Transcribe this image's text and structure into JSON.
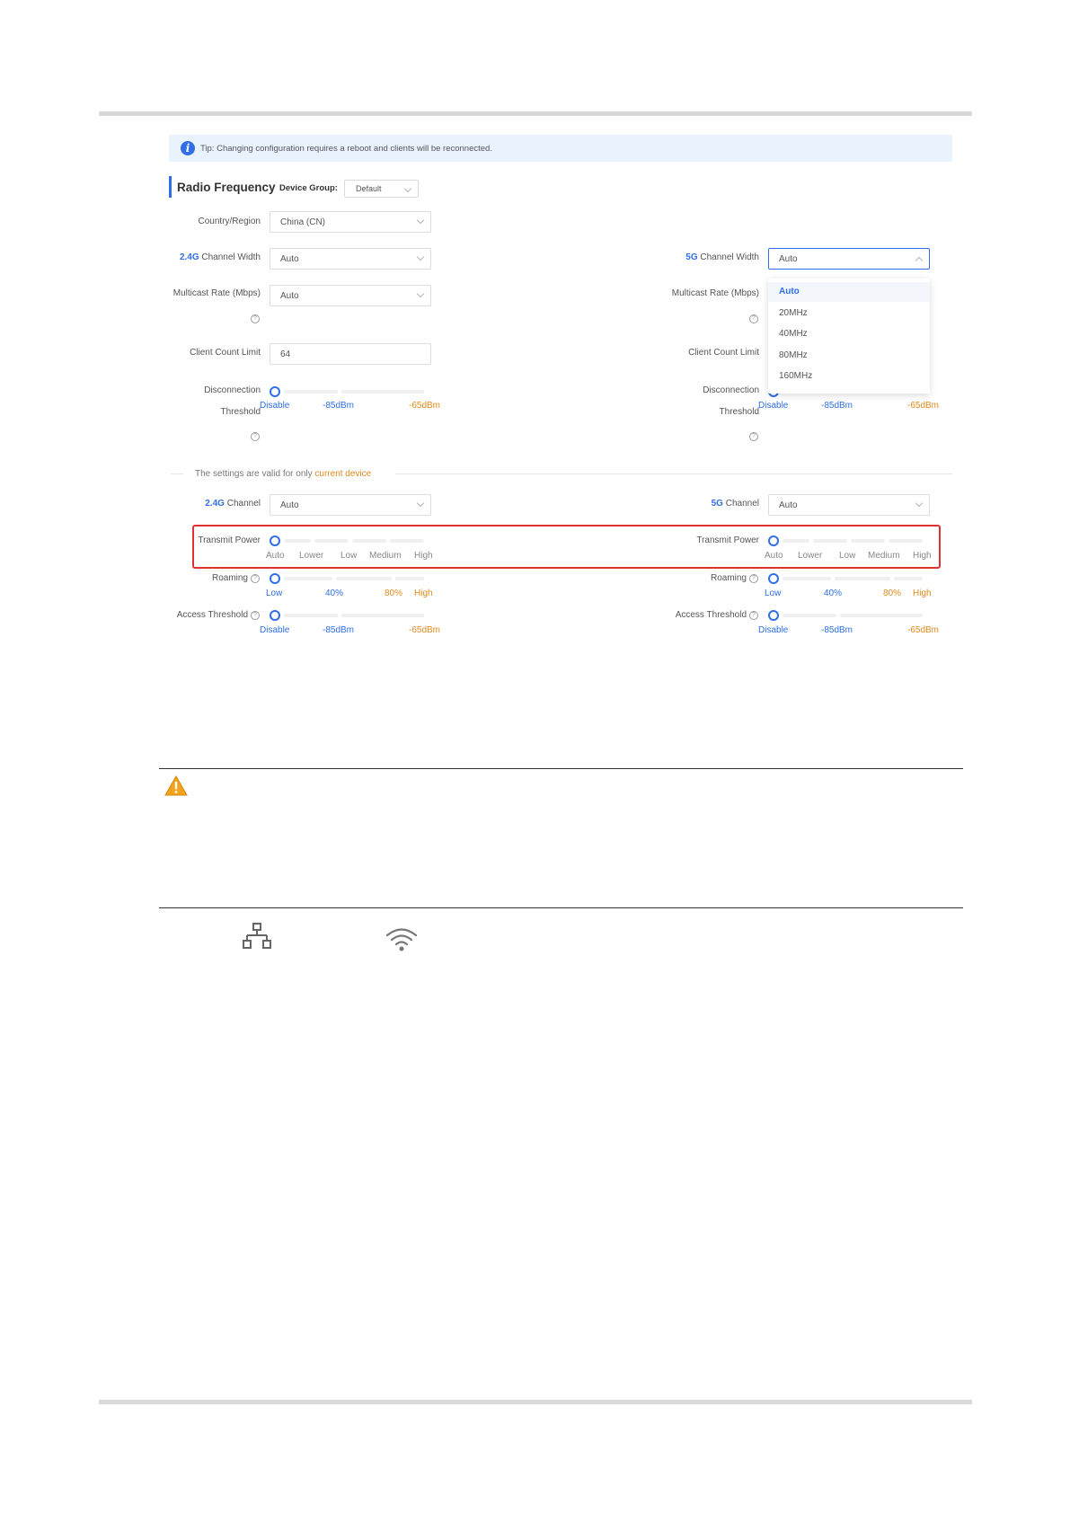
{
  "tip": {
    "text": "Tip: Changing configuration requires a reboot and clients will be reconnected."
  },
  "section": {
    "title": "Radio Frequency",
    "device_group_label": "Device Group:",
    "device_group_value": "Default"
  },
  "country": {
    "label": "Country/Region",
    "value": "China (CN)"
  },
  "left": {
    "channel_width": {
      "band": "2.4G",
      "label": " Channel Width",
      "value": "Auto"
    },
    "multicast": {
      "label": "Multicast Rate (Mbps)",
      "value": "Auto"
    },
    "client_limit": {
      "label": "Client Count Limit",
      "value": "64"
    },
    "disconnect": {
      "label1": "Disconnection",
      "label2": "Threshold",
      "marks": [
        "Disable",
        "-85dBm",
        "-65dBm"
      ]
    },
    "channel": {
      "band": "2.4G",
      "label": " Channel",
      "value": "Auto"
    },
    "transmit": {
      "label": "Transmit Power",
      "marks": [
        "Auto",
        "Lower",
        "Low",
        "Medium",
        "High"
      ]
    },
    "roaming": {
      "label": "Roaming",
      "marks": [
        "Low",
        "40%",
        "80%",
        "High"
      ]
    },
    "access": {
      "label": "Access Threshold",
      "marks": [
        "Disable",
        "-85dBm",
        "-65dBm"
      ]
    }
  },
  "right": {
    "channel_width": {
      "band": "5G",
      "label": " Channel Width",
      "value": "Auto"
    },
    "multicast": {
      "label": "Multicast Rate (Mbps)"
    },
    "client_limit": {
      "label": "Client Count Limit"
    },
    "disconnect": {
      "label1": "Disconnection",
      "label2": "Threshold",
      "marks": [
        "Disable",
        "-85dBm",
        "-65dBm"
      ]
    },
    "channel": {
      "band": "5G",
      "label": " Channel",
      "value": "Auto"
    },
    "transmit": {
      "label": "Transmit Power",
      "marks": [
        "Auto",
        "Lower",
        "Low",
        "Medium",
        "High"
      ]
    },
    "roaming": {
      "label": "Roaming",
      "marks": [
        "Low",
        "40%",
        "80%",
        "High"
      ]
    },
    "access": {
      "label": "Access Threshold",
      "marks": [
        "Disable",
        "-85dBm",
        "-65dBm"
      ]
    }
  },
  "dropdown": {
    "options": [
      "Auto",
      "20MHz",
      "40MHz",
      "80MHz",
      "160MHz"
    ],
    "selected": "Auto"
  },
  "divider": {
    "text": "The settings are valid for only ",
    "highlight": "current device"
  },
  "icons": {
    "info": "info-icon",
    "warning": "warning-icon",
    "lan": "network-topology-icon",
    "wifi": "wifi-icon"
  },
  "colors": {
    "accent": "#2f6ee6",
    "orange": "#e08a1e",
    "highlight_box": "#e03030",
    "tip_bg": "#e9f3fd"
  }
}
